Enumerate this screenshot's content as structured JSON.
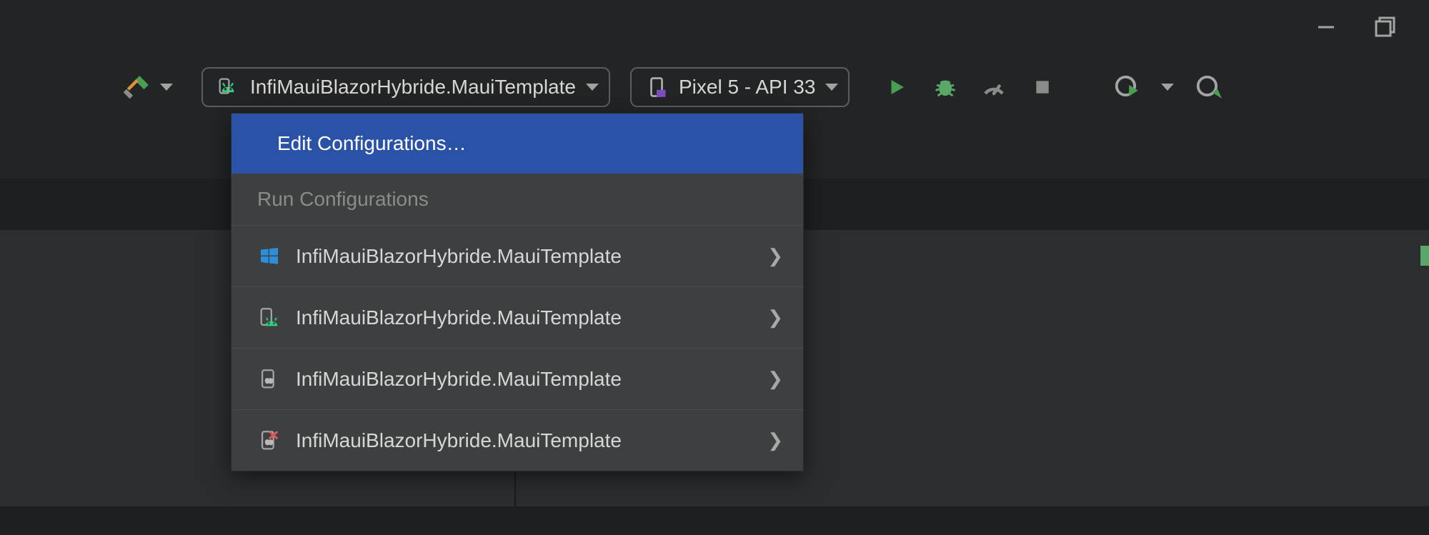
{
  "toolbar": {
    "config_selected": "InfiMauiBlazorHybride.MauiTemplate",
    "device_selected": "Pixel 5 - API 33"
  },
  "dropdown": {
    "edit_label": "Edit Configurations…",
    "section_header": "Run Configurations",
    "items": [
      {
        "icon": "windows",
        "label": "InfiMauiBlazorHybride.MauiTemplate"
      },
      {
        "icon": "android",
        "label": "InfiMauiBlazorHybride.MauiTemplate"
      },
      {
        "icon": "apple",
        "label": "InfiMauiBlazorHybride.MauiTemplate"
      },
      {
        "icon": "apple-error",
        "label": "InfiMauiBlazorHybride.MauiTemplate"
      }
    ]
  }
}
